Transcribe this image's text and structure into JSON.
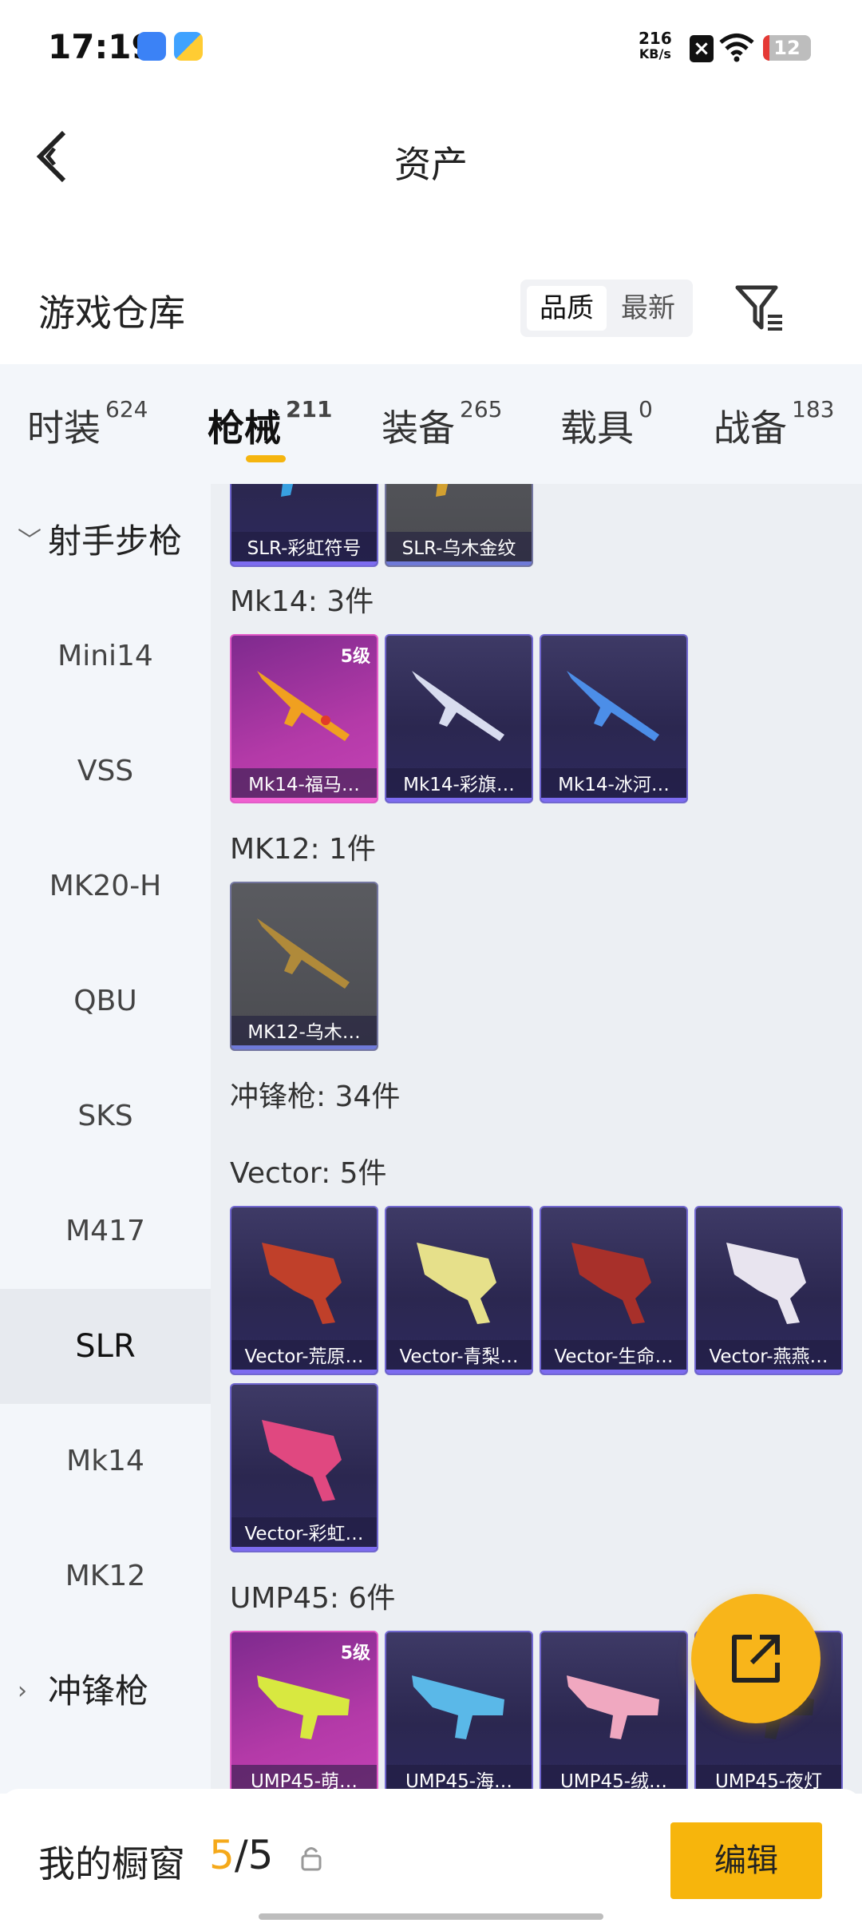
{
  "status_bar": {
    "time": "17:19",
    "net_speed": "216",
    "net_unit": "KB/s",
    "battery": "12"
  },
  "header": {
    "title": "资产"
  },
  "warehouse": {
    "title": "游戏仓库",
    "sort_quality": "品质",
    "sort_newest": "最新"
  },
  "tabs": [
    {
      "label": "时装",
      "count": "624"
    },
    {
      "label": "枪械",
      "count": "211"
    },
    {
      "label": "装备",
      "count": "265"
    },
    {
      "label": "载具",
      "count": "0"
    },
    {
      "label": "战备",
      "count": "183"
    }
  ],
  "sidebar": {
    "group_sniper": "射手步枪",
    "items": [
      "Mini14",
      "VSS",
      "MK20-H",
      "QBU",
      "SKS",
      "M417",
      "SLR",
      "Mk14",
      "MK12"
    ],
    "selected": "SLR",
    "group_smg": "冲锋枪"
  },
  "content": {
    "slr_cards": [
      "SLR-彩虹符号",
      "SLR-乌木金纹"
    ],
    "mk14_label": "Mk14: 3件",
    "mk14_cards": [
      "Mk14-福马…",
      "Mk14-彩旗…",
      "Mk14-冰河…"
    ],
    "mk14_level": "5级",
    "mk12_label": "MK12: 1件",
    "mk12_cards": [
      "MK12-乌木…"
    ],
    "smg_label": "冲锋枪: 34件",
    "vector_label": "Vector: 5件",
    "vector_cards": [
      "Vector-荒原…",
      "Vector-青梨…",
      "Vector-生命…",
      "Vector-燕燕…",
      "Vector-彩虹…"
    ],
    "ump_label": "UMP45: 6件",
    "ump_cards": [
      "UMP45-萌…",
      "UMP45-海…",
      "UMP45-绒…",
      "UMP45-夜灯"
    ],
    "ump_level": "5级"
  },
  "bottom": {
    "showcase_label": "我的橱窗",
    "showcase_current": "5",
    "showcase_total": "/5",
    "edit_label": "编辑"
  },
  "colors": {
    "accent": "#f7b50c",
    "card_purple": "#2b2750",
    "card_pink": "#b43aa8"
  }
}
